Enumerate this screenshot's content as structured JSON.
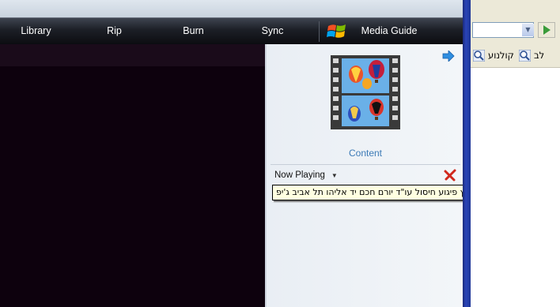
{
  "navbar": {
    "tabs": [
      {
        "label": "Library"
      },
      {
        "label": "Rip"
      },
      {
        "label": "Burn"
      },
      {
        "label": "Sync"
      }
    ],
    "media_guide_label": "Media Guide"
  },
  "panel": {
    "content_label": "Content",
    "now_playing_label": "Now Playing",
    "tooltip_text": "חדשות - פיצוץ פיגוע חיסול עו\"ד יורם חכם יד אליהו תל אביב ג'יפ"
  },
  "browser": {
    "toolbar_buttons": [
      {
        "label": "לב"
      },
      {
        "label": "קולנוע"
      }
    ]
  },
  "colors": {
    "navbar_bg": "#1c1f26",
    "video_bg": "#0d010d",
    "content_link": "#3d7bb6",
    "tooltip_bg": "#ffffe1",
    "separator_blue": "#2a44b8"
  },
  "icons": [
    "windows-logo-icon",
    "forward-arrow-icon",
    "film-strip-icon",
    "dropdown-caret-icon",
    "red-x-icon",
    "magnifier-icon",
    "go-arrow-icon"
  ]
}
